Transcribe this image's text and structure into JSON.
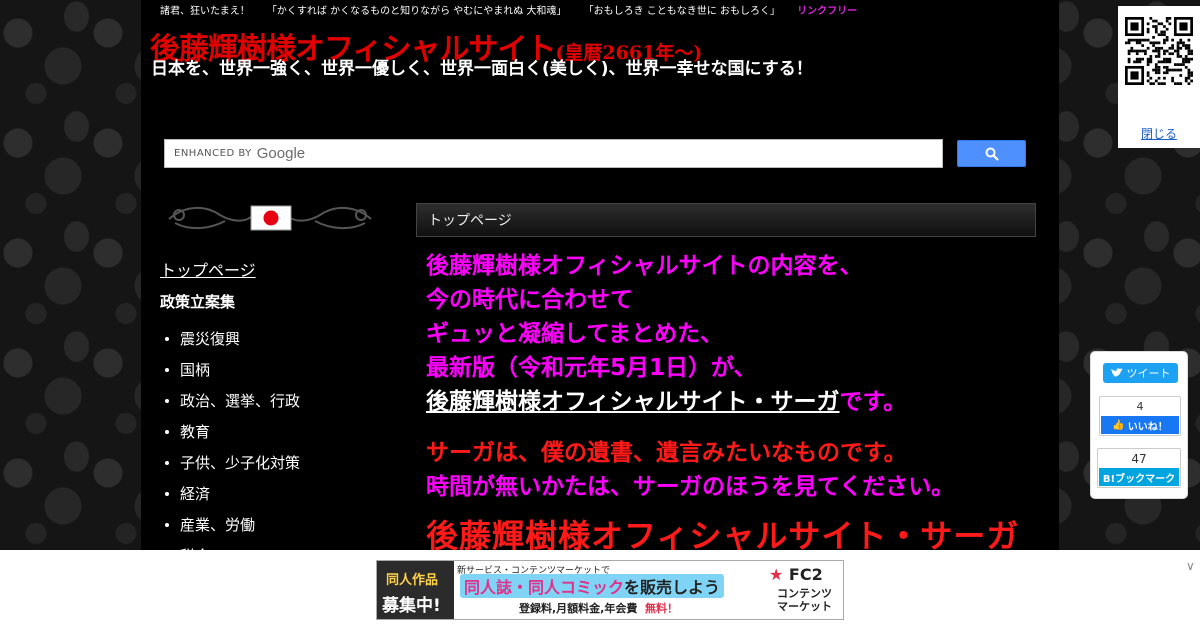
{
  "header": {
    "topline": [
      "諸君、狂いたまえ！",
      "「かくすれば かくなるものと知りながら やむにやまれぬ 大和魂」",
      "「おもしろき こともなき世に おもしろく」"
    ],
    "link_free": "リンクフリー",
    "title_main": "後藤輝樹様オフィシャルサイト",
    "title_sub": "(皇暦2661年～)",
    "tagline": "日本を、世界一強く、世界一優しく、世界一面白く(美しく)、世界一幸せな国にする！"
  },
  "search": {
    "enhanced_by": "ENHANCED BY",
    "google": "Google",
    "icon": "search-icon"
  },
  "sidebar": {
    "top_link": "トップページ",
    "section_title": "政策立案集",
    "items": [
      {
        "label": "震災復興"
      },
      {
        "label": "国柄"
      },
      {
        "label": "政治、選挙、行政"
      },
      {
        "label": "教育"
      },
      {
        "label": "子供、少子化対策"
      },
      {
        "label": "経済"
      },
      {
        "label": "産業、労働"
      },
      {
        "label": "税金"
      }
    ]
  },
  "main": {
    "page_header": "トップページ",
    "lines": [
      "後藤輝樹様オフィシャルサイトの内容を、",
      "今の時代に合わせて",
      "ギュッと凝縮してまとめた、",
      "最新版（令和元年5月1日）が、"
    ],
    "saga_link": "後藤輝樹様オフィシャルサイト・サーガ",
    "saga_suffix": "です。",
    "red_line": "サーガは、僕の遺書、遺言みたいなものです。",
    "pink_line": "時間が無いかたは、サーガのほうを見てください。",
    "big_title": "後藤輝樹様オフィシャルサイト・サーガ"
  },
  "qr_widget": {
    "close_label": "閉じる"
  },
  "share": {
    "tweet_label": "ツイート",
    "fb_count": "4",
    "fb_label": "いいね！",
    "hatena_count": "47",
    "hatena_label": "B!ブックマーク"
  },
  "ad": {
    "left_line1": "同人作品",
    "left_line2": "募集中!",
    "top_text": "新サービス・コンテンツマーケットで",
    "headline_pink": "同人誌・同人コミック",
    "headline_rest": "を販売しよう",
    "fee_text": "登録料,月額料金,年会費",
    "free_text": "無料！",
    "brand": "FC2",
    "brand_sub1": "コンテンツ",
    "brand_sub2": "マーケット"
  },
  "colors": {
    "title_red": "#e00000",
    "content_pink": "#ff00ff",
    "content_red": "#ff1a1a",
    "link_free": "#e020e0",
    "search_button": "#4d90fe"
  }
}
